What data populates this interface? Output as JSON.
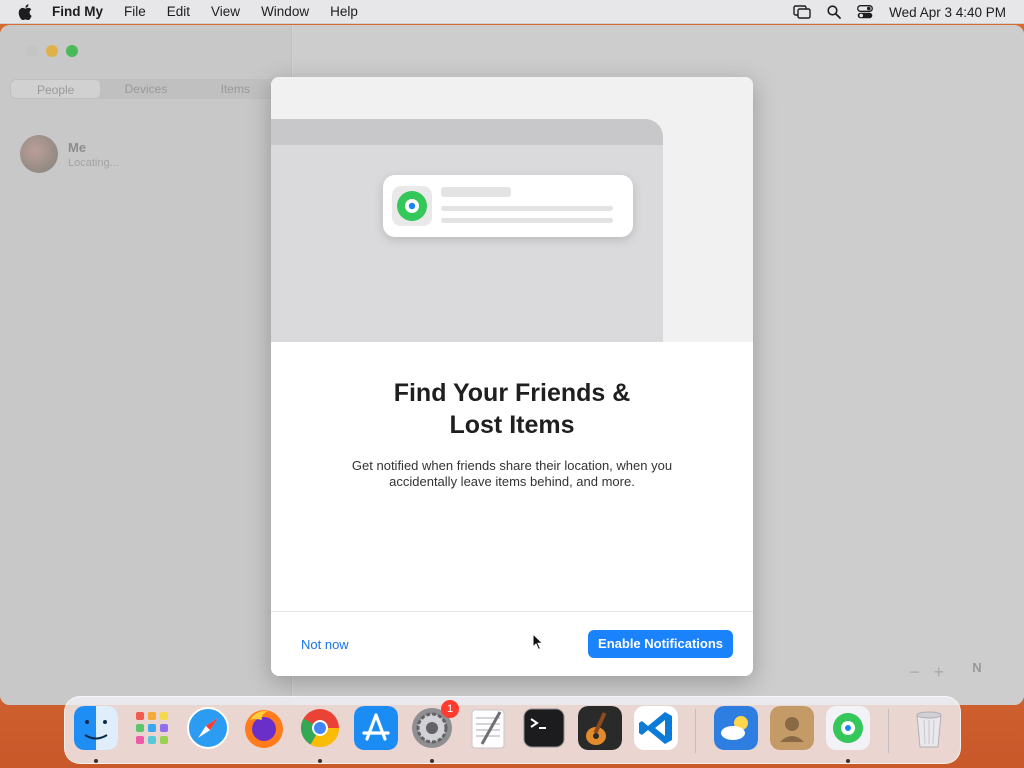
{
  "menubar": {
    "app_name": "Find My",
    "items": [
      "File",
      "Edit",
      "View",
      "Window",
      "Help"
    ],
    "datetime": "Wed Apr 3  4:40 PM"
  },
  "sidebar": {
    "tabs": [
      "People",
      "Devices",
      "Items"
    ],
    "me": {
      "name": "Me",
      "status": "Locating..."
    }
  },
  "map": {
    "zoom_out": "−",
    "zoom_in": "+",
    "compass": "N"
  },
  "modal": {
    "title_line1": "Find Your Friends &",
    "title_line2": "Lost Items",
    "description_line1": "Get notified when friends share their location, when you",
    "description_line2": "accidentally leave items behind, and more.",
    "secondary_button": "Not now",
    "primary_button": "Enable Notifications"
  },
  "dock": {
    "apps": [
      "Finder",
      "Launchpad",
      "Safari",
      "Firefox",
      "Chrome",
      "App Store",
      "System Settings",
      "TextEdit",
      "Terminal",
      "GarageBand",
      "VS Code",
      "Weather",
      "Contacts",
      "Find My",
      "Trash"
    ],
    "settings_badge": "1"
  },
  "colors": {
    "accent": "#1a82fb",
    "link": "#1a73e8",
    "badge": "#ff3b30",
    "findmy_green": "#34c759"
  }
}
